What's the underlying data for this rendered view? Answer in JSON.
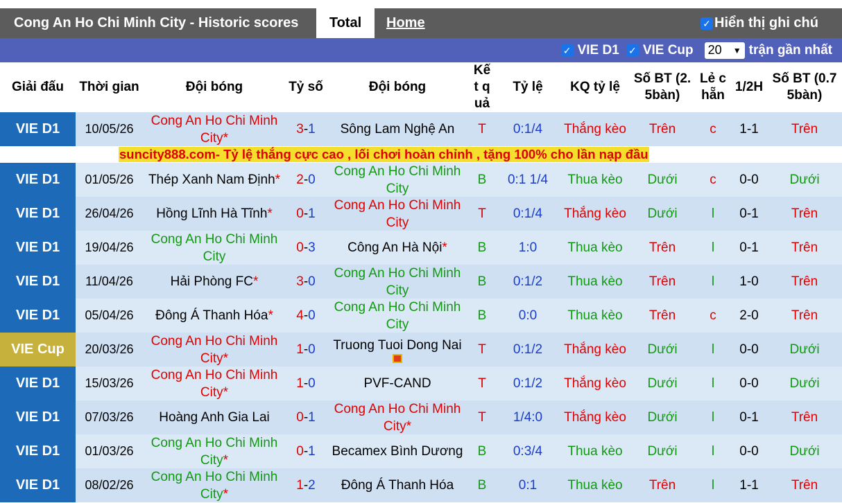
{
  "header": {
    "title": "Cong An Ho Chi Minh City - Historic scores",
    "tab_total": "Total",
    "tab_home": "Home",
    "note_label": "Hiển thị ghi chú"
  },
  "filters": {
    "league1": "VIE D1",
    "league2": "VIE Cup",
    "count": "20",
    "count_suffix": "trận gần nhất"
  },
  "columns": {
    "league": "Giải đấu",
    "time": "Thời gian",
    "home": "Đội bóng",
    "score": "Tỷ số",
    "away": "Đội bóng",
    "result": "Kết quả",
    "odds": "Tỷ lệ",
    "odds_result": "KQ tỷ lệ",
    "goals25": "Số BT (2.5bàn)",
    "oddeven": "Lẻ chẵn",
    "half": "1/2H",
    "goals075": "Số BT (0.75bàn)"
  },
  "ad_text": "suncity888.com- Tỷ lệ thắng cực cao , lối chơi hoàn chỉnh , tặng 100% cho lần nạp đầu",
  "colors": {
    "league_d1": "#1d6ab9",
    "league_cup": "#c6b13d",
    "filterbar": "#5160b8",
    "titlebar": "#5c5c5c",
    "win": "#e00000",
    "lose": "#119911",
    "score_home": "#e00000",
    "score_away": "#1a3ccc"
  },
  "rows": [
    {
      "league": "VIE D1",
      "cup": false,
      "date": "10/05/26",
      "home": "Cong An Ho Chi Minh City",
      "home_star": "*",
      "home_color": "red",
      "score_h": "3",
      "score_a": "1",
      "away": "Sông Lam Nghệ An",
      "away_star": "",
      "away_color": "dark",
      "away_flag": false,
      "result": "T",
      "odds": "0:1/4",
      "odds_result": "Thắng kèo",
      "goals25": "Trên",
      "oe": "c",
      "half": "1-1",
      "goals075": "Trên"
    },
    {
      "league": "VIE D1",
      "cup": false,
      "date": "01/05/26",
      "home": "Thép Xanh Nam Định",
      "home_star": "*",
      "home_color": "dark",
      "score_h": "2",
      "score_a": "0",
      "away": "Cong An Ho Chi Minh City",
      "away_star": "",
      "away_color": "green",
      "away_flag": false,
      "result": "B",
      "odds": "0:1 1/4",
      "odds_result": "Thua kèo",
      "goals25": "Dưới",
      "oe": "c",
      "half": "0-0",
      "goals075": "Dưới"
    },
    {
      "league": "VIE D1",
      "cup": false,
      "date": "26/04/26",
      "home": "Hồng Lĩnh Hà Tĩnh",
      "home_star": "*",
      "home_color": "dark",
      "score_h": "0",
      "score_a": "1",
      "away": "Cong An Ho Chi Minh City",
      "away_star": "",
      "away_color": "red",
      "away_flag": false,
      "result": "T",
      "odds": "0:1/4",
      "odds_result": "Thắng kèo",
      "goals25": "Dưới",
      "oe": "l",
      "half": "0-1",
      "goals075": "Trên"
    },
    {
      "league": "VIE D1",
      "cup": false,
      "date": "19/04/26",
      "home": "Cong An Ho Chi Minh City",
      "home_star": "",
      "home_color": "green",
      "score_h": "0",
      "score_a": "3",
      "away": "Công An Hà Nội",
      "away_star": "*",
      "away_color": "dark",
      "away_flag": false,
      "result": "B",
      "odds": "1:0",
      "odds_result": "Thua kèo",
      "goals25": "Trên",
      "oe": "l",
      "half": "0-1",
      "goals075": "Trên"
    },
    {
      "league": "VIE D1",
      "cup": false,
      "date": "11/04/26",
      "home": "Hải Phòng FC",
      "home_star": "*",
      "home_color": "dark",
      "score_h": "3",
      "score_a": "0",
      "away": "Cong An Ho Chi Minh City",
      "away_star": "",
      "away_color": "green",
      "away_flag": false,
      "result": "B",
      "odds": "0:1/2",
      "odds_result": "Thua kèo",
      "goals25": "Trên",
      "oe": "l",
      "half": "1-0",
      "goals075": "Trên"
    },
    {
      "league": "VIE D1",
      "cup": false,
      "date": "05/04/26",
      "home": "Đông Á Thanh Hóa",
      "home_star": "*",
      "home_color": "dark",
      "score_h": "4",
      "score_a": "0",
      "away": "Cong An Ho Chi Minh City",
      "away_star": "",
      "away_color": "green",
      "away_flag": false,
      "result": "B",
      "odds": "0:0",
      "odds_result": "Thua kèo",
      "goals25": "Trên",
      "oe": "c",
      "half": "2-0",
      "goals075": "Trên"
    },
    {
      "league": "VIE Cup",
      "cup": true,
      "date": "20/03/26",
      "home": "Cong An Ho Chi Minh City",
      "home_star": "*",
      "home_color": "red",
      "score_h": "1",
      "score_a": "0",
      "away": "Truong Tuoi Dong Nai",
      "away_star": "",
      "away_color": "dark",
      "away_flag": true,
      "result": "T",
      "odds": "0:1/2",
      "odds_result": "Thắng kèo",
      "goals25": "Dưới",
      "oe": "l",
      "half": "0-0",
      "goals075": "Dưới"
    },
    {
      "league": "VIE D1",
      "cup": false,
      "date": "15/03/26",
      "home": "Cong An Ho Chi Minh City",
      "home_star": "*",
      "home_color": "red",
      "score_h": "1",
      "score_a": "0",
      "away": "PVF-CAND",
      "away_star": "",
      "away_color": "dark",
      "away_flag": false,
      "result": "T",
      "odds": "0:1/2",
      "odds_result": "Thắng kèo",
      "goals25": "Dưới",
      "oe": "l",
      "half": "0-0",
      "goals075": "Dưới"
    },
    {
      "league": "VIE D1",
      "cup": false,
      "date": "07/03/26",
      "home": "Hoàng Anh Gia Lai",
      "home_star": "",
      "home_color": "dark",
      "score_h": "0",
      "score_a": "1",
      "away": "Cong An Ho Chi Minh City",
      "away_star": "*",
      "away_color": "red",
      "away_flag": false,
      "result": "T",
      "odds": "1/4:0",
      "odds_result": "Thắng kèo",
      "goals25": "Dưới",
      "oe": "l",
      "half": "0-1",
      "goals075": "Trên"
    },
    {
      "league": "VIE D1",
      "cup": false,
      "date": "01/03/26",
      "home": "Cong An Ho Chi Minh City",
      "home_star": "*",
      "home_color": "green",
      "score_h": "0",
      "score_a": "1",
      "away": "Becamex Bình Dương",
      "away_star": "",
      "away_color": "dark",
      "away_flag": false,
      "result": "B",
      "odds": "0:3/4",
      "odds_result": "Thua kèo",
      "goals25": "Dưới",
      "oe": "l",
      "half": "0-0",
      "goals075": "Dưới"
    },
    {
      "league": "VIE D1",
      "cup": false,
      "date": "08/02/26",
      "home": "Cong An Ho Chi Minh City",
      "home_star": "*",
      "home_color": "green",
      "score_h": "1",
      "score_a": "2",
      "away": "Đông Á Thanh Hóa",
      "away_star": "",
      "away_color": "dark",
      "away_flag": false,
      "result": "B",
      "odds": "0:1",
      "odds_result": "Thua kèo",
      "goals25": "Trên",
      "oe": "l",
      "half": "1-1",
      "goals075": "Trên"
    }
  ]
}
